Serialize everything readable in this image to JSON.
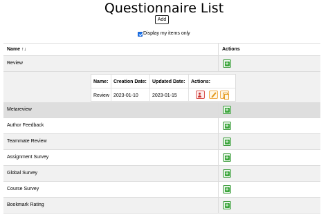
{
  "page": {
    "title": "Questionnaire List",
    "add_label": "Add",
    "filter_label": "Display my items only"
  },
  "table": {
    "col_name": "Name",
    "sort_icon": "↑↓",
    "col_actions": "Actions",
    "rows": [
      "Review",
      "Metareview",
      "Author Feedback",
      "Teammate Review",
      "Assignment Survey",
      "Global Survey",
      "Course Survey",
      "Bookmark Rating"
    ]
  },
  "subtable": {
    "headers": [
      "Name:",
      "Creation Date:",
      "Updated Date:",
      "Actions:"
    ],
    "row": {
      "name": "Review",
      "created": "2023-01-10",
      "updated": "2023-01-15"
    }
  },
  "colors": {
    "accent_green": "#3aa53a",
    "delete_red": "#d9534f",
    "edit_orange": "#f0ad4e"
  },
  "icons": [
    "sort-icon",
    "add-icon",
    "delete-user-icon",
    "edit-icon",
    "copy-icon"
  ]
}
